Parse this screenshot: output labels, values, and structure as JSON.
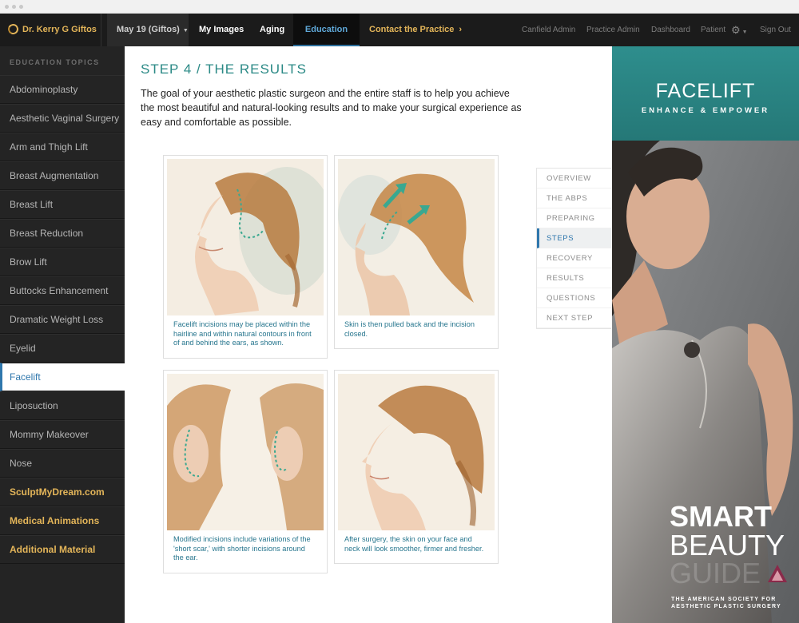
{
  "topnav": {
    "practice_name": "Dr. Kerry G Giftos",
    "date_selector": "May 19 (Giftos)",
    "my_images": "My Images",
    "aging": "Aging",
    "education": "Education",
    "contact": "Contact the Practice",
    "canfield_admin": "Canfield Admin",
    "practice_admin": "Practice Admin",
    "dashboard": "Dashboard",
    "patient": "Patient",
    "sign_out": "Sign Out"
  },
  "sidebar": {
    "heading": "EDUCATION TOPICS",
    "items": [
      {
        "label": "Abdominoplasty"
      },
      {
        "label": "Aesthetic Vaginal Surgery"
      },
      {
        "label": "Arm and Thigh Lift"
      },
      {
        "label": "Breast Augmentation"
      },
      {
        "label": "Breast Lift"
      },
      {
        "label": "Breast Reduction"
      },
      {
        "label": "Brow Lift"
      },
      {
        "label": "Buttocks Enhancement"
      },
      {
        "label": "Dramatic Weight Loss"
      },
      {
        "label": "Eyelid"
      },
      {
        "label": "Facelift"
      },
      {
        "label": "Liposuction"
      },
      {
        "label": "Mommy Makeover"
      },
      {
        "label": "Nose"
      },
      {
        "label": "SculptMyDream.com"
      },
      {
        "label": "Medical Animations"
      },
      {
        "label": "Additional Material"
      }
    ]
  },
  "main": {
    "title": "STEP 4 / THE RESULTS",
    "intro": "The goal of your aesthetic plastic surgeon and the entire staff is to help you achieve the most beautiful and natural-looking results and to make your surgical experience as easy and comfortable as possible.",
    "cards": [
      {
        "caption": "Facelift incisions may be placed within the hairline and within natural contours in front of and behind the ears, as shown."
      },
      {
        "caption": "Skin is then pulled back and the incision closed."
      },
      {
        "caption": "Modified incisions include variations of the 'short scar,' with shorter incisions around the ear."
      },
      {
        "caption": "After surgery, the skin on your face and neck will look smoother, firmer and fresher."
      }
    ]
  },
  "steps_nav": [
    "OVERVIEW",
    "THE ABPS",
    "PREPARING",
    "STEPS",
    "RECOVERY",
    "RESULTS",
    "QUESTIONS",
    "NEXT STEP"
  ],
  "promo": {
    "title": "FACELIFT",
    "tagline": "ENHANCE & EMPOWER",
    "smart": "SMART",
    "beauty": "BEAUTY",
    "guide": "GUIDE",
    "society": "THE AMERICAN SOCIETY FOR AESTHETIC PLASTIC SURGERY"
  },
  "colors": {
    "accent_teal": "#2b8a86",
    "accent_gold": "#e3b559",
    "accent_blue": "#2f77ad",
    "caption_teal": "#27768e"
  },
  "icons": [
    "logo-ring-icon",
    "caret-down-icon",
    "chevron-right-icon",
    "gear-icon"
  ]
}
